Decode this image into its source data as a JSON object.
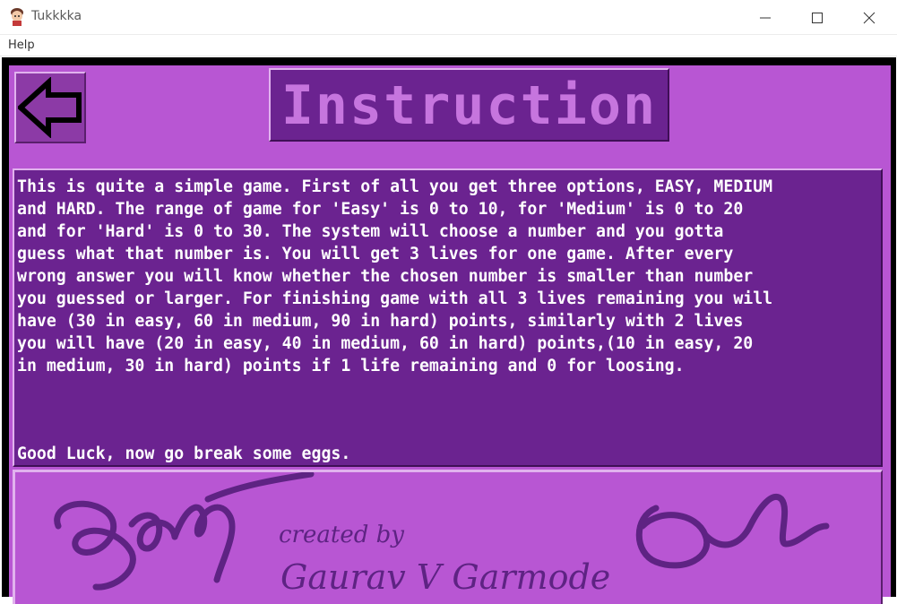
{
  "window": {
    "title": "Tukkkka",
    "icon": "girl-avatar-icon",
    "controls": [
      "minimize-icon",
      "maximize-icon",
      "close-icon"
    ]
  },
  "menu": {
    "items": [
      "Help"
    ]
  },
  "page": {
    "title": "Instruction",
    "back_icon": "left-arrow-icon",
    "instructions": "This is quite a simple game. First of all you get three options, EASY, MEDIUM\nand HARD. The range of game for 'Easy' is 0 to 10, for 'Medium' is 0 to 20\nand for 'Hard' is 0 to 30. The system will choose a number and you gotta\nguess what that number is. You will get 3 lives for one game. After every\nwrong answer you will know whether the chosen number is smaller than number\nyou guessed or larger. For finishing game with all 3 lives remaining you will\nhave (30 in easy, 60 in medium, 90 in hard) points, similarly with 2 lives\nyou will have (20 in easy, 40 in medium, 60 in hard) points,(10 in easy, 20\nin medium, 30 in hard) points if 1 life remaining and 0 for loosing.",
    "closing": "Good Luck, now go break some eggs."
  },
  "credits": {
    "created_by": "created by",
    "author": "Gaurav V Garmode"
  },
  "colors": {
    "panel": "#b856d3",
    "dark_box": "#6b2390",
    "title_text": "#c675de",
    "frame": "#000000"
  }
}
